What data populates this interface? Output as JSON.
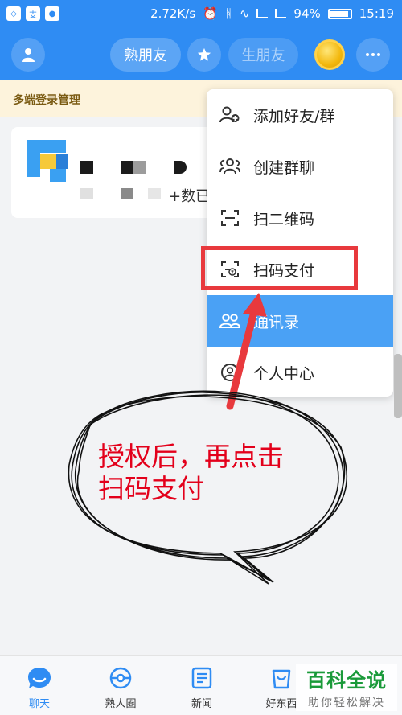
{
  "status_bar": {
    "speed": "2.72K/s",
    "battery": "94%",
    "battery_level": 0.94,
    "time": "15:19"
  },
  "header": {
    "tab_familiar": "熟朋友",
    "tab_stranger": "生朋友"
  },
  "banner": {
    "text": "多端登录管理"
  },
  "session_card": {
    "preview_fragment": "+数已"
  },
  "menu": {
    "items": [
      {
        "label": "添加好友/群",
        "icon": "add-friend-icon"
      },
      {
        "label": "创建群聊",
        "icon": "group-chat-icon"
      },
      {
        "label": "扫二维码",
        "icon": "scan-qr-icon"
      },
      {
        "label": "扫码支付",
        "icon": "scan-pay-icon"
      },
      {
        "label": "通讯录",
        "icon": "contacts-icon"
      },
      {
        "label": "个人中心",
        "icon": "profile-icon"
      }
    ],
    "selected_index": 4
  },
  "annotation": {
    "text_line1": "授权后，再点击",
    "text_line2": "扫码支付",
    "color": "#e3001b"
  },
  "bottom_nav": {
    "items": [
      {
        "label": "聊天",
        "active": true
      },
      {
        "label": "熟人圈",
        "active": false
      },
      {
        "label": "新闻",
        "active": false
      },
      {
        "label": "好东西",
        "active": false
      }
    ]
  },
  "watermark": {
    "title": "百科全说",
    "subtitle": "助你轻松解决"
  },
  "colors": {
    "primary": "#2f8cf3",
    "menu_selected": "#4aa1f5",
    "highlight_red": "#e8393d"
  }
}
